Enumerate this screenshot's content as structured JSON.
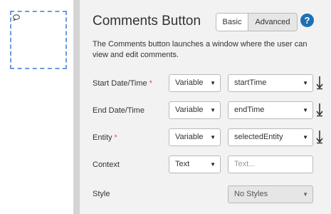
{
  "panel": {
    "title": "Comments Button",
    "tabs": {
      "basic": "Basic",
      "advanced": "Advanced",
      "active": "Advanced"
    },
    "help_icon": "?",
    "description": "The Comments button launches a window where the user can view and edit comments."
  },
  "fields": {
    "start": {
      "label": "Start Date/Time",
      "required": "*",
      "mode": "Variable",
      "value": "startTime"
    },
    "end": {
      "label": "End Date/Time",
      "mode": "Variable",
      "value": "endTime"
    },
    "entity": {
      "label": "Entity",
      "required": "*",
      "mode": "Variable",
      "value": "selectedEntity"
    },
    "context": {
      "label": "Context",
      "mode": "Text",
      "placeholder": "Text..."
    },
    "style": {
      "label": "Style",
      "value": "No Styles"
    }
  },
  "caret": "▼",
  "colors": {
    "accent": "#1e6fb5",
    "required": "#d9534f",
    "selection_border": "#6a9be0"
  }
}
